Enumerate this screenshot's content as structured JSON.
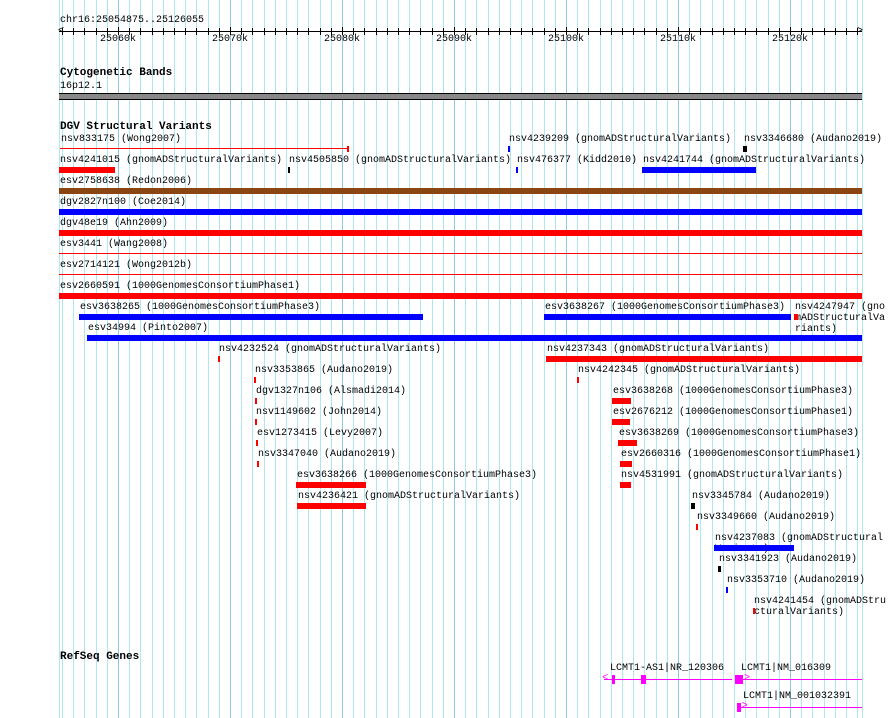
{
  "ruler": {
    "position": "chr16:25054875..25126055",
    "view_start": 25054875,
    "view_end": 25126055,
    "tick_labels": [
      "25060k",
      "25070k",
      "25080k",
      "25090k",
      "25100k",
      "25110k",
      "25120k"
    ]
  },
  "cytoband_track": {
    "title": "Cytogenetic Bands",
    "band": "16p12.1",
    "band_color": "#888888"
  },
  "dgv_track": {
    "title": "DGV Structural Variants",
    "colors": {
      "loss": "#ff0000",
      "gain": "#0000ff",
      "gain_loss": "#8b4513",
      "other": "#000000"
    },
    "rows": [
      [
        {
          "id": "nsv833175",
          "source": "Wong2007",
          "color": "#ff0000",
          "start_kb": 25054.8,
          "end_kb": 25080.6,
          "style": "line-end"
        },
        {
          "id": "nsv4239209",
          "source": "gnomADStructuralVariants",
          "color": "#0000ff",
          "start_kb": 25094.8,
          "end_kb": 25095.0
        },
        {
          "id": "nsv3346680",
          "source": "Audano2019",
          "color": "#000000",
          "start_kb": 25115.8,
          "end_kb": 25116.2
        }
      ],
      [
        {
          "id": "nsv4241015",
          "source": "gnomADStructuralVariants",
          "color": "#ff0000",
          "start_kb": 25054.7,
          "end_kb": 25059.7
        },
        {
          "id": "nsv4505850",
          "source": "gnomADStructuralVariants",
          "color": "#000000",
          "start_kb": 25075.2,
          "end_kb": 25075.4
        },
        {
          "id": "nsv476377",
          "source": "Kidd2010",
          "color": "#0000ff",
          "start_kb": 25095.5,
          "end_kb": 25095.7
        },
        {
          "id": "nsv4241744",
          "source": "gnomADStructuralVariants",
          "color": "#0000ff",
          "start_kb": 25106.8,
          "end_kb": 25117.0
        }
      ],
      [
        {
          "id": "esv2758638",
          "source": "Redon2006",
          "color": "#8b4513",
          "start_kb": 25054.0,
          "end_kb": 25127.0
        }
      ],
      [
        {
          "id": "dgv2827n100",
          "source": "Coe2014",
          "color": "#0000ff",
          "start_kb": 25054.0,
          "end_kb": 25127.0
        }
      ],
      [
        {
          "id": "dgv48e19",
          "source": "Ahn2009",
          "color": "#ff0000",
          "start_kb": 25054.0,
          "end_kb": 25127.0
        }
      ],
      [
        {
          "id": "esv3441",
          "source": "Wang2008",
          "color": "#ff0000",
          "start_kb": 25054.0,
          "end_kb": 25127.0,
          "style": "line"
        }
      ],
      [
        {
          "id": "esv2714121",
          "source": "Wong2012b",
          "color": "#ff0000",
          "start_kb": 25054.0,
          "end_kb": 25127.0,
          "style": "line"
        }
      ],
      [
        {
          "id": "esv2660591",
          "source": "1000GenomesConsortiumPhase1",
          "color": "#ff0000",
          "start_kb": 25054.0,
          "end_kb": 25127.0
        }
      ],
      [
        {
          "id": "esv3638265",
          "source": "1000GenomesConsortiumPhase3",
          "color": "#0000ff",
          "start_kb": 25056.5,
          "end_kb": 25087.2
        },
        {
          "id": "esv3638267",
          "source": "1000GenomesConsortiumPhase3",
          "color": "#0000ff",
          "start_kb": 25098.0,
          "end_kb": 25120.1
        },
        {
          "id": "nsv4247947",
          "source": "gnomADStructuralVariants",
          "color": "#ff0000",
          "start_kb": 25120.4,
          "end_kb": 25120.7
        }
      ],
      [
        {
          "id": "esv34994",
          "source": "Pinto2007",
          "color": "#0000ff",
          "start_kb": 25057.2,
          "end_kb": 25127.0
        }
      ],
      [
        {
          "id": "nsv4232524",
          "source": "gnomADStructuralVariants",
          "color": "#ff0000",
          "start_kb": 25068.9,
          "end_kb": 25069.1
        },
        {
          "id": "nsv4237343",
          "source": "gnomADStructuralVariants",
          "color": "#ff0000",
          "start_kb": 25098.2,
          "end_kb": 25127.0
        }
      ],
      [
        {
          "id": "nsv3353865",
          "source": "Audano2019",
          "color": "#ff0000",
          "start_kb": 25072.1,
          "end_kb": 25072.3
        },
        {
          "id": "nsv4242345",
          "source": "gnomADStructuralVariants",
          "color": "#ff0000",
          "start_kb": 25101.0,
          "end_kb": 25101.2
        }
      ],
      [
        {
          "id": "dgv1327n106",
          "source": "Alsmadi2014",
          "color": "#ff0000",
          "start_kb": 25072.2,
          "end_kb": 25072.4
        },
        {
          "id": "esv3638268",
          "source": "1000GenomesConsortiumPhase3",
          "color": "#ff0000",
          "start_kb": 25104.1,
          "end_kb": 25105.8
        }
      ],
      [
        {
          "id": "nsv1149602",
          "source": "John2014",
          "color": "#ff0000",
          "start_kb": 25072.2,
          "end_kb": 25072.4
        },
        {
          "id": "esv2676212",
          "source": "1000GenomesConsortiumPhase1",
          "color": "#ff0000",
          "start_kb": 25104.1,
          "end_kb": 25105.7
        }
      ],
      [
        {
          "id": "esv1273415",
          "source": "Levy2007",
          "color": "#ff0000",
          "start_kb": 25072.3,
          "end_kb": 25072.5
        },
        {
          "id": "esv3638269",
          "source": "1000GenomesConsortiumPhase3",
          "color": "#ff0000",
          "start_kb": 25104.6,
          "end_kb": 25106.3
        }
      ],
      [
        {
          "id": "nsv3347040",
          "source": "Audano2019",
          "color": "#ff0000",
          "start_kb": 25072.4,
          "end_kb": 25072.6
        },
        {
          "id": "esv2660316",
          "source": "1000GenomesConsortiumPhase1",
          "color": "#ff0000",
          "start_kb": 25104.8,
          "end_kb": 25105.9
        }
      ],
      [
        {
          "id": "esv3638266",
          "source": "1000GenomesConsortiumPhase3",
          "color": "#ff0000",
          "start_kb": 25075.9,
          "end_kb": 25082.1
        },
        {
          "id": "nsv4531991",
          "source": "gnomADStructuralVariants",
          "color": "#ff0000",
          "start_kb": 25104.8,
          "end_kb": 25105.8
        }
      ],
      [
        {
          "id": "nsv4236421",
          "source": "gnomADStructuralVariants",
          "color": "#ff0000",
          "start_kb": 25076.0,
          "end_kb": 25082.1
        },
        {
          "id": "nsv3345784",
          "source": "Audano2019",
          "color": "#000000",
          "start_kb": 25111.2,
          "end_kb": 25111.5
        }
      ],
      [
        {
          "id": "nsv3349660",
          "source": "Audano2019",
          "color": "#ff0000",
          "start_kb": 25111.6,
          "end_kb": 25111.8
        }
      ],
      [
        {
          "id": "nsv4237083",
          "source": "gnomADStructuralVariants",
          "color": "#0000ff",
          "start_kb": 25113.2,
          "end_kb": 25120.4
        }
      ],
      [
        {
          "id": "nsv3341923",
          "source": "Audano2019",
          "color": "#000000",
          "start_kb": 25113.6,
          "end_kb": 25113.8
        }
      ],
      [
        {
          "id": "nsv3353710",
          "source": "Audano2019",
          "color": "#0000ff",
          "start_kb": 25114.3,
          "end_kb": 25114.5
        }
      ],
      [
        {
          "id": "nsv4241454",
          "source": "gnomADStructuralVariants",
          "color": "#ff0000",
          "start_kb": 25116.7,
          "end_kb": 25116.9
        }
      ]
    ]
  },
  "refseq_track": {
    "title": "RefSeq Genes",
    "color": "#ff00ff",
    "genes": [
      {
        "label": "LCMT1-AS1|NR_120306",
        "strand": "-",
        "start_kb": 25103.4,
        "end_kb": 25114.8,
        "exons_kb": [
          [
            25104.1,
            25104.3
          ],
          [
            25106.7,
            25107.1
          ]
        ],
        "row": 0
      },
      {
        "label": "LCMT1|NM_016309",
        "strand": "+",
        "start_kb": 25115.1,
        "end_kb": 25127.0,
        "exons_kb": [
          [
            25115.1,
            25115.8
          ]
        ],
        "row": 0,
        "label_kb": 25115.1
      },
      {
        "label": "LCMT1|NM_001032391",
        "strand": "+",
        "start_kb": 25115.3,
        "end_kb": 25127.0,
        "exons_kb": [
          [
            25115.3,
            25115.6
          ]
        ],
        "row": 1
      }
    ]
  }
}
